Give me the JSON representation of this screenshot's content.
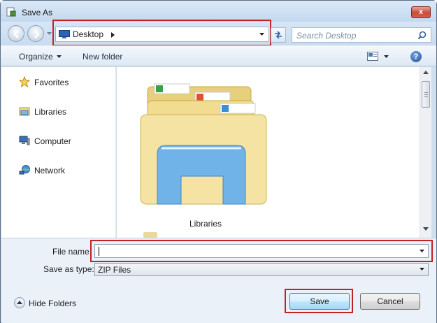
{
  "window": {
    "title": "Save As"
  },
  "titlebar": {
    "close_glyph": "x"
  },
  "nav": {
    "address": "Desktop",
    "search_placeholder": "Search Desktop"
  },
  "toolbar": {
    "organize": "Organize",
    "new_folder": "New folder"
  },
  "sidebar": {
    "items": [
      {
        "label": "Favorites",
        "icon": "star-icon"
      },
      {
        "label": "Libraries",
        "icon": "libraries-icon"
      },
      {
        "label": "Computer",
        "icon": "computer-icon"
      },
      {
        "label": "Network",
        "icon": "network-icon"
      }
    ]
  },
  "content": {
    "items": [
      {
        "label": "Libraries",
        "icon": "libraries-folder-icon"
      }
    ]
  },
  "form": {
    "file_name_label": "File name:",
    "file_name_value": "",
    "save_as_type_label": "Save as type:",
    "save_as_type_value": "ZIP Files"
  },
  "footer": {
    "hide_folders": "Hide Folders",
    "save": "Save",
    "cancel": "Cancel"
  },
  "colors": {
    "highlight": "#c42127",
    "accent": "#3c7fb1"
  }
}
